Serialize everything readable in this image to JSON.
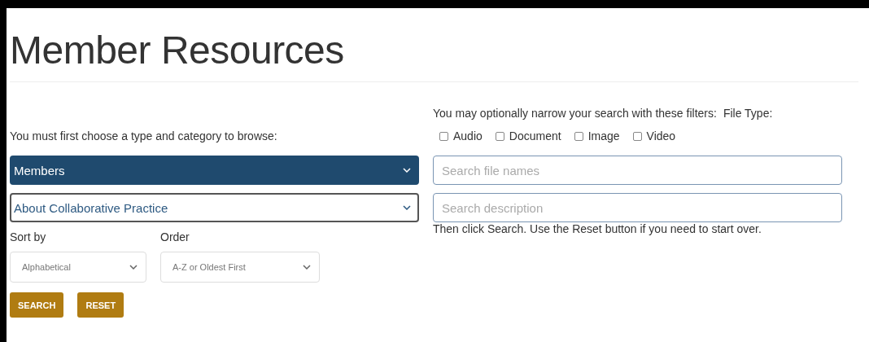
{
  "title": "Member Resources",
  "browse_label": "You must first choose a type and category to browse:",
  "filter_label": "You may optionally narrow your search with these filters:",
  "file_type_label": "File Type:",
  "file_types": [
    {
      "label": "Audio",
      "checked": false
    },
    {
      "label": "Document",
      "checked": false
    },
    {
      "label": "Image",
      "checked": false
    },
    {
      "label": "Video",
      "checked": false
    }
  ],
  "type_dropdowns": [
    {
      "value": "Members",
      "highlighted": true
    },
    {
      "value": "About Collaborative Practice",
      "highlighted": false
    }
  ],
  "search_fields": [
    {
      "placeholder": "Search file names"
    },
    {
      "placeholder": "Search description"
    }
  ],
  "hint": "Then click Search. Use the Reset button if you need to start over.",
  "sort": {
    "label": "Sort by",
    "value": "Alphabetical"
  },
  "order": {
    "label": "Order",
    "value": "A-Z or Oldest First"
  },
  "buttons": [
    "SEARCH",
    "RESET"
  ]
}
